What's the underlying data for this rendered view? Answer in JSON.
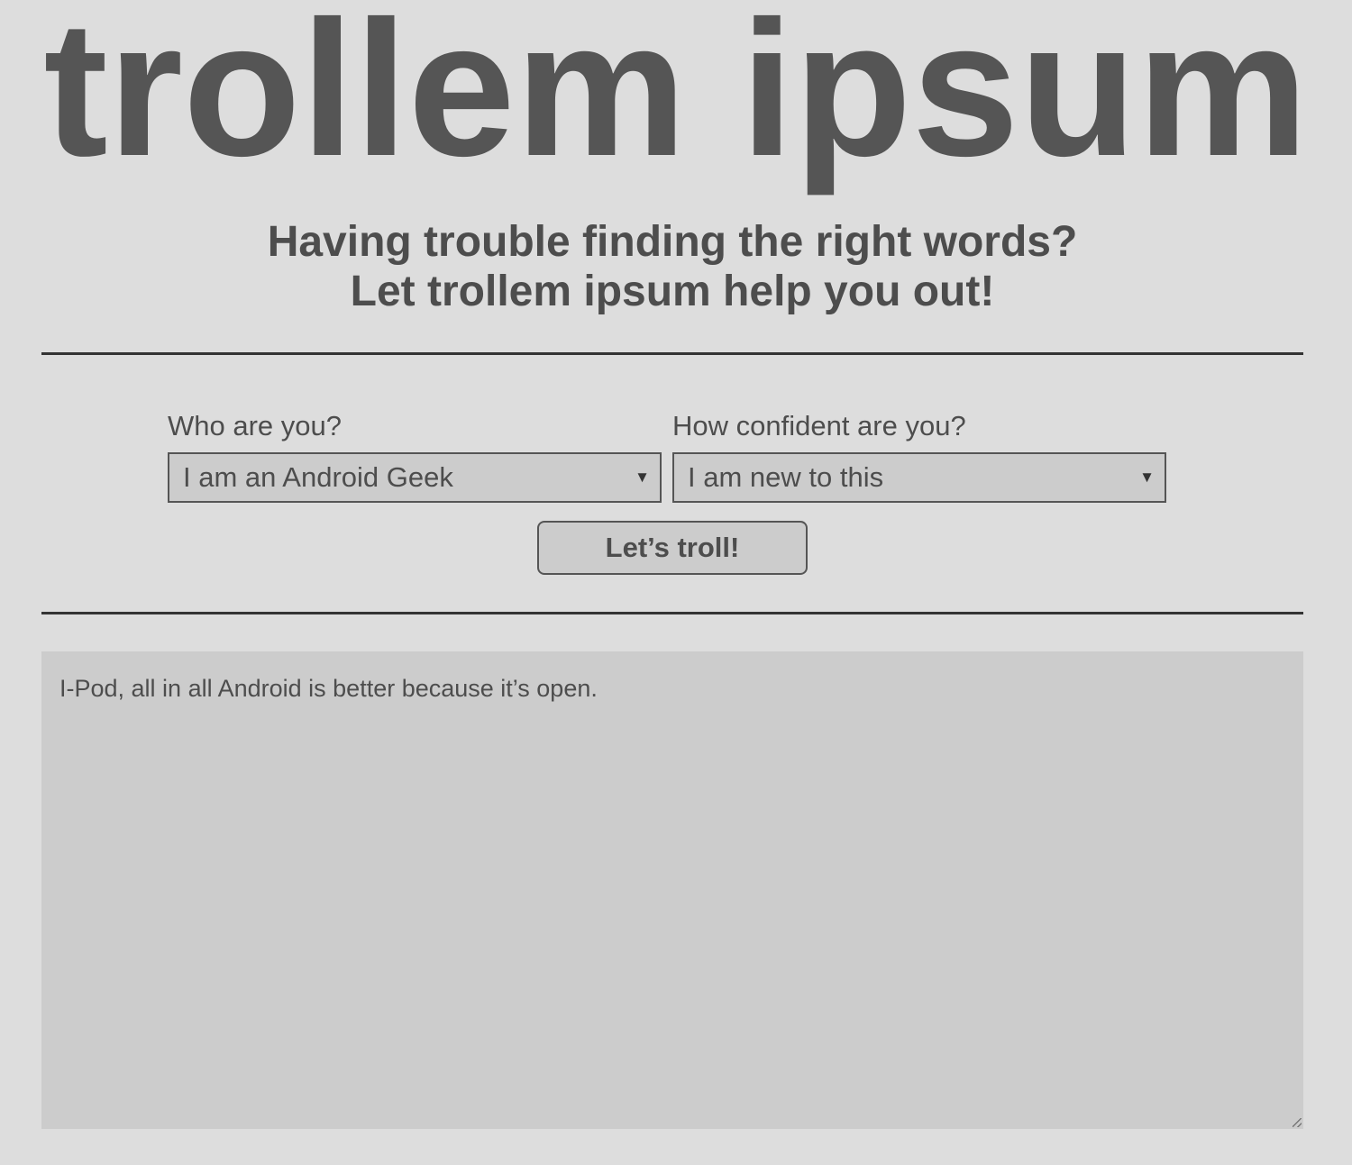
{
  "header": {
    "logo_text": "trollem ipsum",
    "tagline_line1": "Having trouble finding the right words?",
    "tagline_line2": "Let trollem ipsum help you out!"
  },
  "form": {
    "identity": {
      "label": "Who are you?",
      "selected": "I am an Android Geek"
    },
    "confidence": {
      "label": "How confident are you?",
      "selected": "I am new to this"
    },
    "submit_label": "Let’s troll!"
  },
  "output": {
    "text": "I-Pod, all in all Android is better because it’s open."
  },
  "icons": {
    "dropdown": "chevron-down-icon",
    "resize": "resize-grip-icon"
  },
  "colors": {
    "background": "#dddddd",
    "text": "#555555",
    "control_fill": "#cccccc",
    "divider": "#333333"
  }
}
